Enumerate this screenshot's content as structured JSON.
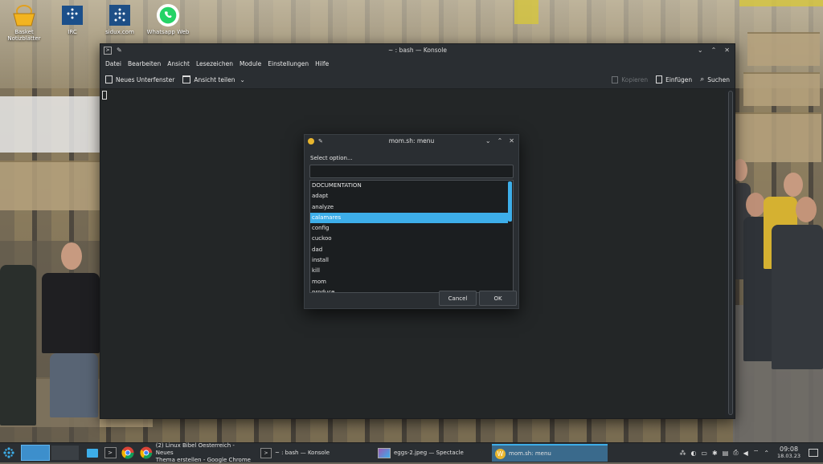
{
  "desktop": {
    "icons": [
      {
        "label": "Basket\nNotizblätter",
        "icon": "basket-icon"
      },
      {
        "label": "IRC",
        "icon": "irc-icon"
      },
      {
        "label": "sidux.com",
        "icon": "sidux-icon"
      },
      {
        "label": "Whatsapp Web",
        "icon": "whatsapp-icon"
      }
    ]
  },
  "konsole": {
    "title": "~ : bash — Konsole",
    "menu": [
      "Datei",
      "Bearbeiten",
      "Ansicht",
      "Lesezeichen",
      "Module",
      "Einstellungen",
      "Hilfe"
    ],
    "toolbar": {
      "new_tab": "Neues Unterfenster",
      "split_view": "Ansicht teilen",
      "copy": "Kopieren",
      "paste": "Einfügen",
      "search": "Suchen"
    }
  },
  "dialog": {
    "title": "mom.sh: menu",
    "label": "Select option...",
    "input_value": "",
    "items": [
      "DOCUMENTATION",
      "adapt",
      "analyze",
      "calamares",
      "config",
      "cuckoo",
      "dad",
      "install",
      "kill",
      "mom",
      "produce"
    ],
    "selected_index": 3,
    "cancel": "Cancel",
    "ok": "OK"
  },
  "taskbar": {
    "tasks": [
      {
        "label": "(2) Linux Bibel Oesterreich - Neues Thema erstellen - Google Chrome",
        "label1": "(2) Linux Bibel Oesterreich - Neues",
        "label2": "Thema erstellen - Google Chrome"
      },
      {
        "label": "~ : bash — Konsole"
      },
      {
        "label": "eggs-2.jpeg — Spectacle"
      },
      {
        "label": "mom.sh: menu"
      }
    ],
    "clock_time": "09:08",
    "clock_date": "18.03.23"
  },
  "colors": {
    "accent": "#3daee9",
    "window_bg": "#232629",
    "titlebar_bg": "#2a2e32"
  }
}
